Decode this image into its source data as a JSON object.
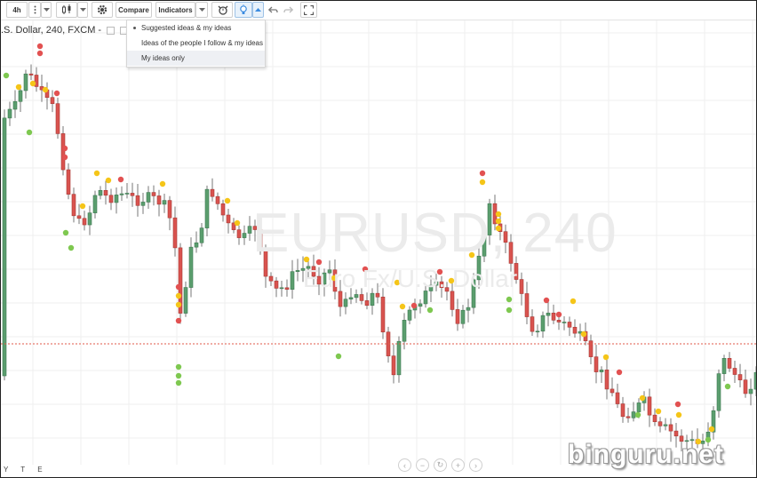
{
  "toolbar": {
    "interval": "4h",
    "compare_label": "Compare",
    "indicators_label": "Indicators"
  },
  "symbol": {
    "description": ".S. Dollar, 240, FXCM -"
  },
  "watermark": {
    "symbol": "EURUSD, 240",
    "description": "Euro Fx/U.S. Dollar"
  },
  "ideas_menu": {
    "items": [
      {
        "label": "Suggested ideas & my ideas",
        "selected": true
      },
      {
        "label": "Ideas of the people I follow & my ideas",
        "selected": false
      },
      {
        "label": "My ideas only",
        "selected": false
      }
    ]
  },
  "time_axis": {
    "labels": [
      "Y",
      "T",
      "E"
    ]
  },
  "brand": {
    "text": "binguru.net"
  },
  "colors": {
    "bull": "#5b9e6e",
    "bear": "#d9534f",
    "idea_red": "#e25151",
    "idea_yellow": "#f5c518",
    "idea_green": "#7ec850",
    "price_line": "#e05a4a"
  },
  "icons": [
    "candles-icon",
    "gear-icon",
    "alert-clock-icon",
    "lightbulb-icon",
    "undo-icon",
    "redo-icon",
    "fullscreen-icon"
  ]
}
